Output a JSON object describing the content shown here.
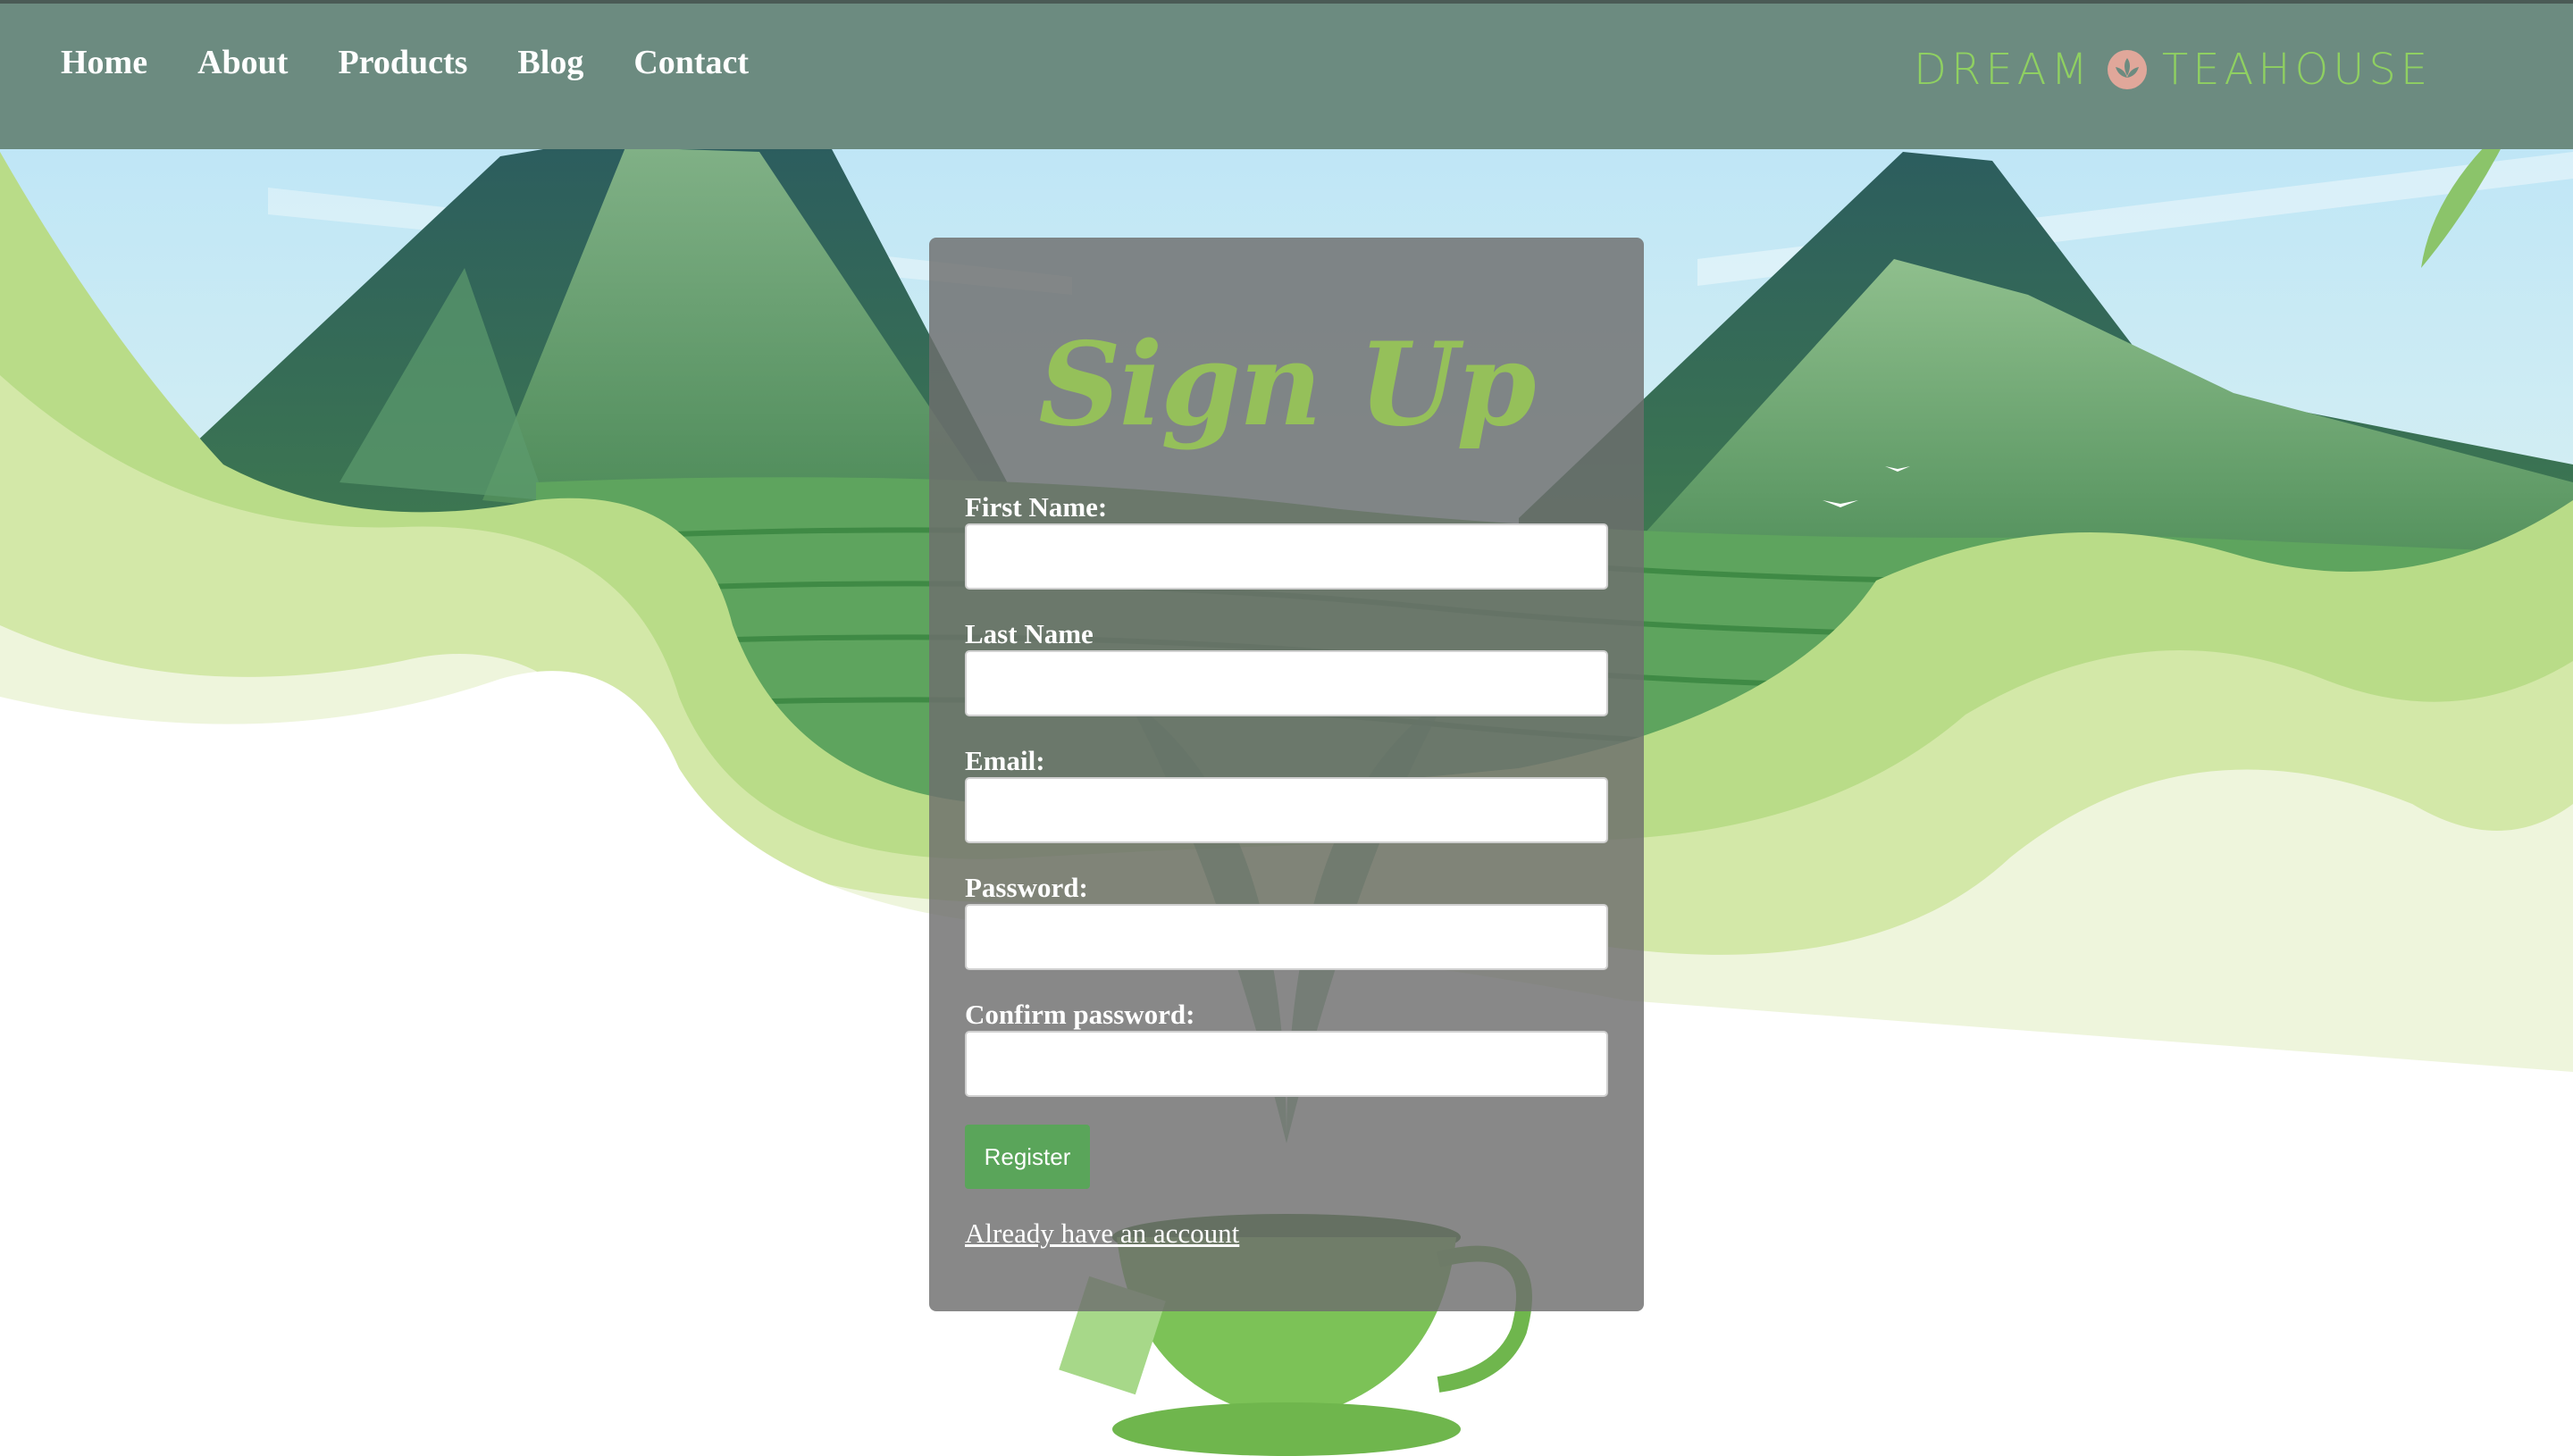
{
  "nav": {
    "links": [
      "Home",
      "About",
      "Products",
      "Blog",
      "Contact"
    ],
    "brand_left": "DREAM",
    "brand_right": "TEAHOUSE"
  },
  "form": {
    "title": "Sign Up",
    "fields": [
      {
        "label": "First Name:",
        "value": ""
      },
      {
        "label": "Last Name",
        "value": ""
      },
      {
        "label": "Email:",
        "value": ""
      },
      {
        "label": "Password:",
        "value": ""
      },
      {
        "label": "Confirm password:",
        "value": ""
      }
    ],
    "register_label": "Register",
    "login_link": "Already have an account"
  },
  "colors": {
    "navbar": "#6c8b80",
    "brand": "#8fd061",
    "title": "#95c05a",
    "register_button": "#5aa55a",
    "panel": "#6e6e6e"
  }
}
